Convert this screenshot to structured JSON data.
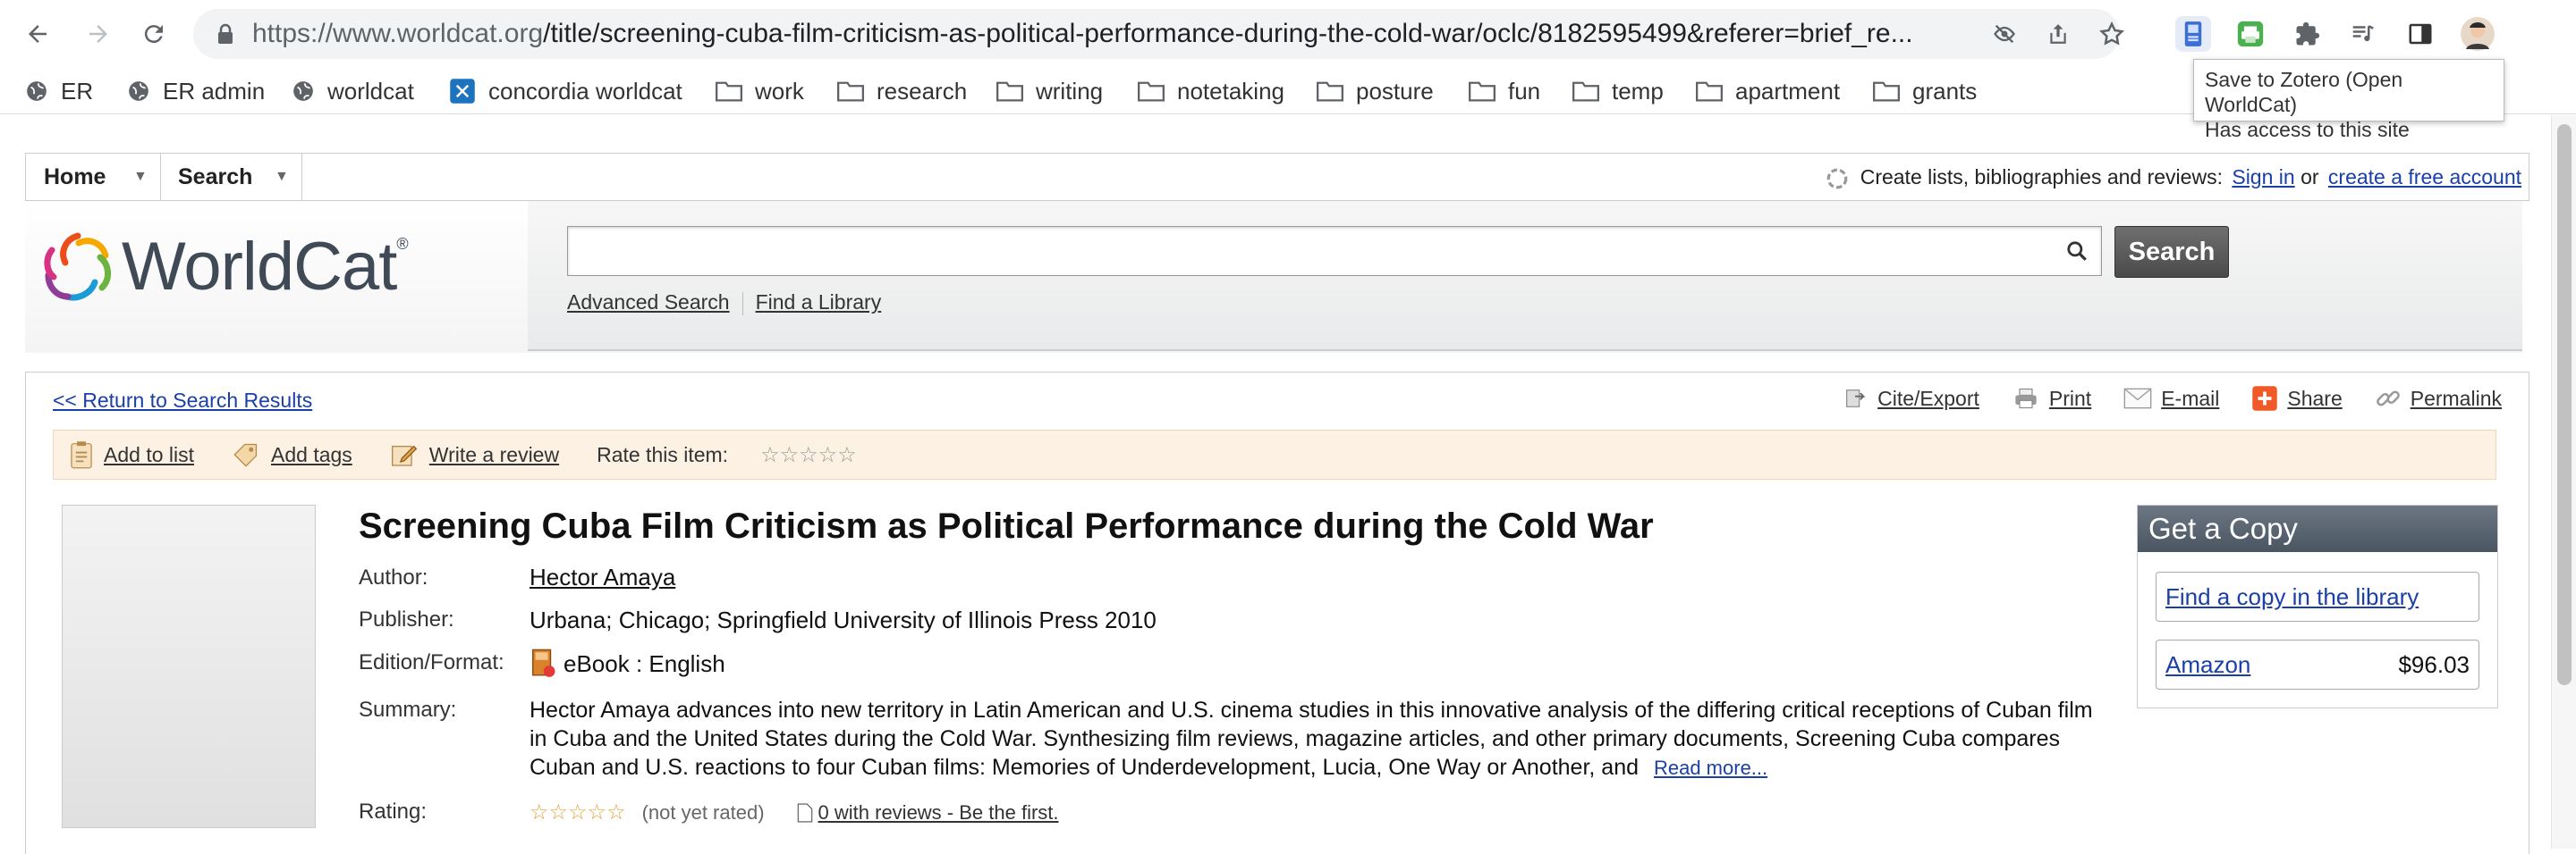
{
  "browser": {
    "url_host": "https://www.worldcat.org",
    "url_path": "/title/screening-cuba-film-criticism-as-political-performance-during-the-cold-war/oclc/8182595499&referer=brief_re...",
    "tooltip_line1": "Save to Zotero (Open WorldCat)",
    "tooltip_line2": "Has access to this site"
  },
  "bookmarks": [
    {
      "label": "ER",
      "icon": "globe-icon"
    },
    {
      "label": "ER admin",
      "icon": "globe-icon"
    },
    {
      "label": "worldcat",
      "icon": "globe-icon"
    },
    {
      "label": "concordia worldcat",
      "icon": "concordia-icon"
    },
    {
      "label": "work",
      "icon": "folder-icon"
    },
    {
      "label": "research",
      "icon": "folder-icon"
    },
    {
      "label": "writing",
      "icon": "folder-icon"
    },
    {
      "label": "notetaking",
      "icon": "folder-icon"
    },
    {
      "label": "posture",
      "icon": "folder-icon"
    },
    {
      "label": "fun",
      "icon": "folder-icon"
    },
    {
      "label": "temp",
      "icon": "folder-icon"
    },
    {
      "label": "apartment",
      "icon": "folder-icon"
    },
    {
      "label": "grants",
      "icon": "folder-icon"
    }
  ],
  "nav": {
    "home": "Home",
    "search": "Search",
    "right_text": "Create lists, bibliographies and reviews:",
    "sign_in": "Sign in",
    "or": "or",
    "create_account": "create a free account"
  },
  "header": {
    "logo_text": "WorldCat",
    "search_button": "Search",
    "advanced_search": "Advanced Search",
    "find_library": "Find a Library"
  },
  "record": {
    "return_link": "<< Return to Search Results",
    "tools": {
      "cite": "Cite/Export",
      "print": "Print",
      "email": "E-mail",
      "share": "Share",
      "permalink": "Permalink"
    },
    "actions": {
      "add_list": "Add to list",
      "add_tags": "Add tags",
      "write_review": "Write a review",
      "rate": "Rate this item:"
    },
    "title": "Screening Cuba Film Criticism as Political Performance during the Cold War",
    "labels": {
      "author": "Author:",
      "publisher": "Publisher:",
      "edition": "Edition/Format:",
      "summary": "Summary:",
      "rating": "Rating:"
    },
    "author": "Hector Amaya",
    "publisher": "Urbana; Chicago; Springfield University of Illinois Press 2010",
    "edition": "eBook : English",
    "summary": "Hector Amaya advances into new territory in Latin American and U.S. cinema studies in this innovative analysis of the differing critical receptions of Cuban film in Cuba and the United States during the Cold War. Synthesizing film reviews, magazine articles, and other primary documents, Screening Cuba compares Cuban and U.S. reactions to four Cuban films: Memories of Underdevelopment, Lucia, One Way or Another, and",
    "read_more": "Read more...",
    "rating_note": "(not yet rated)",
    "reviews_link": "0 with reviews - Be the first."
  },
  "get_copy": {
    "heading": "Get a Copy",
    "find_copy": "Find a copy in the library",
    "amazon": "Amazon",
    "amazon_price": "$96.03"
  }
}
